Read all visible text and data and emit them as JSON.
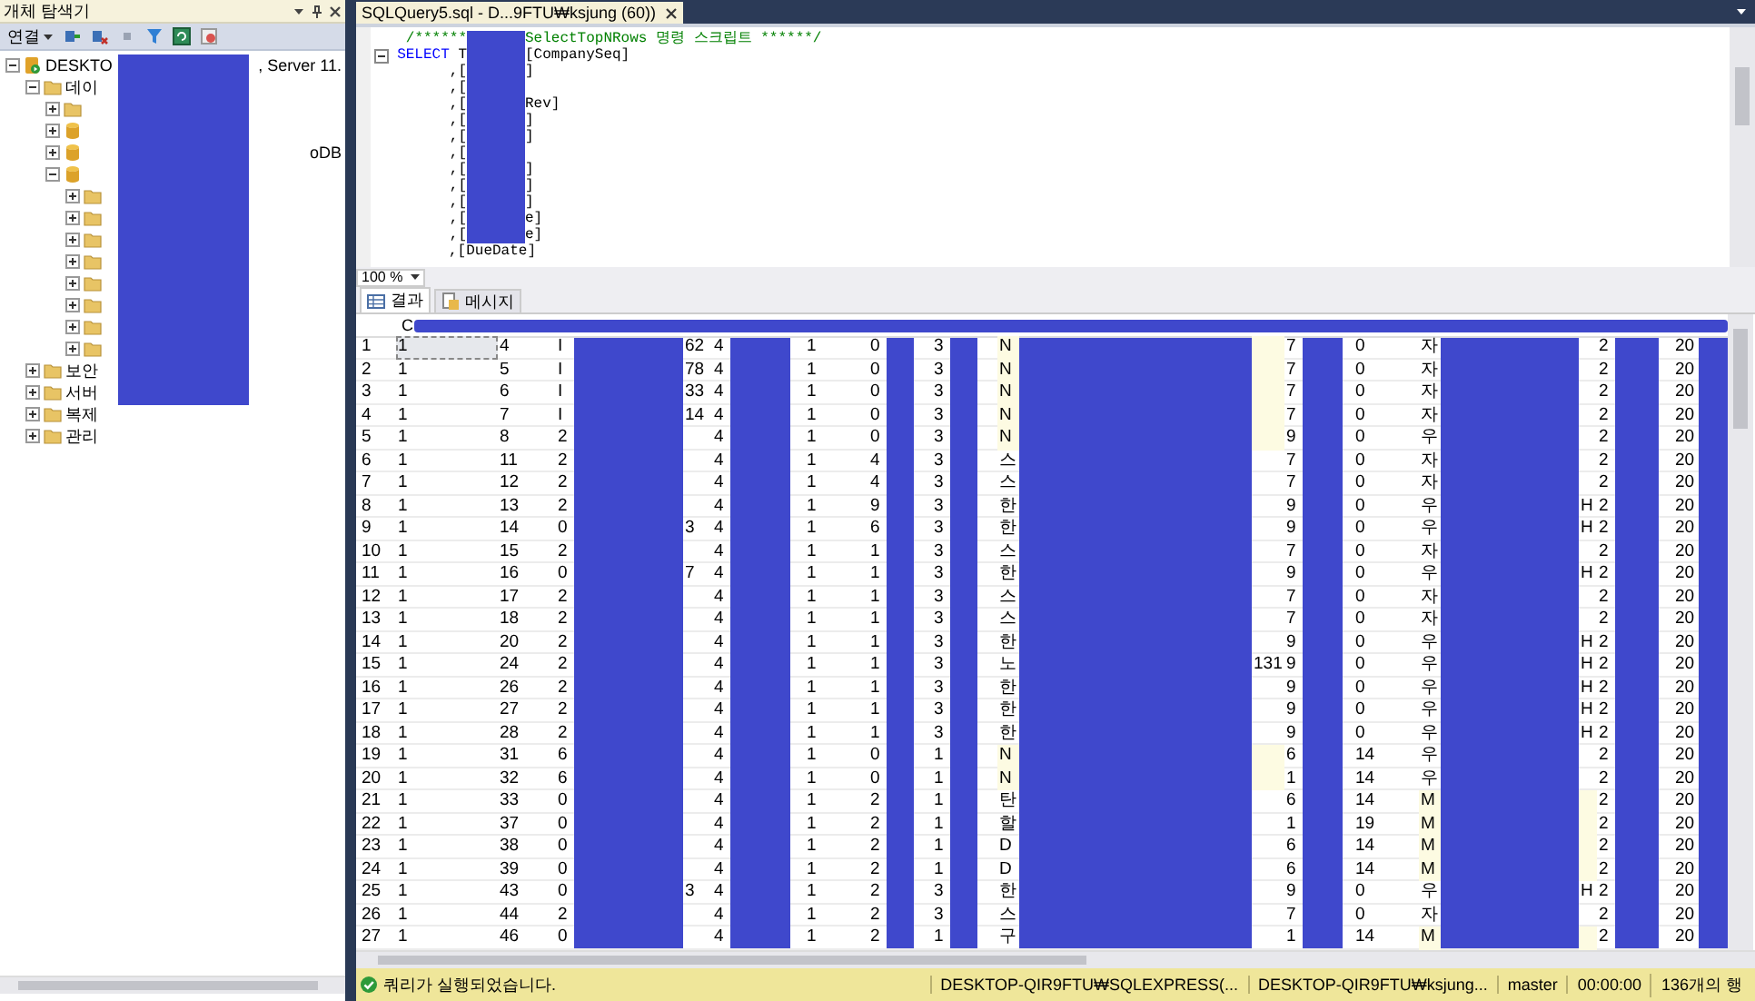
{
  "object_explorer": {
    "title": "개체 탐색기",
    "connect_label": "연결",
    "tree": [
      {
        "kind": "server",
        "label": "DESKTO",
        "tail": ", Server 11.",
        "expanded": true,
        "children": [
          {
            "kind": "folder",
            "label": "데이",
            "expanded": true,
            "children": [
              {
                "kind": "folder",
                "expanded": false
              },
              {
                "kind": "database",
                "expanded": false
              },
              {
                "kind": "database",
                "tail": "oDB",
                "expanded": false
              },
              {
                "kind": "database",
                "expanded": true,
                "children": [
                  {
                    "kind": "folder",
                    "expanded": false
                  },
                  {
                    "kind": "folder",
                    "expanded": false
                  },
                  {
                    "kind": "folder",
                    "expanded": false
                  },
                  {
                    "kind": "folder",
                    "expanded": false
                  },
                  {
                    "kind": "folder",
                    "expanded": false
                  },
                  {
                    "kind": "folder",
                    "expanded": false
                  },
                  {
                    "kind": "folder",
                    "expanded": false
                  },
                  {
                    "kind": "folder",
                    "expanded": false
                  }
                ]
              }
            ]
          },
          {
            "kind": "folder",
            "label": "보안",
            "expanded": false
          },
          {
            "kind": "folder",
            "label": "서버",
            "expanded": false
          },
          {
            "kind": "folder",
            "label": "복제",
            "expanded": false
          },
          {
            "kind": "folder",
            "label": "관리",
            "expanded": false
          }
        ]
      }
    ]
  },
  "editor": {
    "tab_title": "SQLQuery5.sql - D...9FTU₩ksjung (60))",
    "zoom": "100 %",
    "lines": [
      {
        "kind": "comment",
        "lead": "/******",
        "tail": "SelectTopNRows 명령 스크립트 ******/"
      },
      {
        "kind": "select",
        "keyword": "SELECT",
        "lead": "T",
        "tail": "[CompanySeq]"
      },
      {
        "kind": "column",
        "lead": ",[",
        "tail": "]"
      },
      {
        "kind": "column",
        "lead": ",["
      },
      {
        "kind": "column",
        "lead": ",[",
        "tail": "Rev]"
      },
      {
        "kind": "column",
        "lead": ",[",
        "tail": "]"
      },
      {
        "kind": "column",
        "lead": ",[",
        "tail": "]"
      },
      {
        "kind": "column",
        "lead": ",["
      },
      {
        "kind": "column",
        "lead": ",[",
        "tail": "]"
      },
      {
        "kind": "column",
        "lead": ",[",
        "tail": "]"
      },
      {
        "kind": "column",
        "lead": ",[",
        "tail": "]"
      },
      {
        "kind": "column",
        "lead": ",[",
        "tail": "e]"
      },
      {
        "kind": "column",
        "lead": ",[",
        "tail": "e]"
      },
      {
        "kind": "full",
        "lead": ",[DueDate]"
      }
    ]
  },
  "results": {
    "tabs": [
      {
        "label": "결과",
        "selected": true
      },
      {
        "label": "메시지",
        "selected": false
      }
    ],
    "header_fragment": "C",
    "rows": [
      {
        "n": "1",
        "selected": true,
        "column_9_shaded": true,
        "column_12_shaded": false,
        "cells": [
          "1",
          "4",
          "I",
          "62",
          "4",
          "1",
          "0",
          "3",
          "N",
          null,
          "7",
          "0",
          "자",
          null,
          "2",
          "20"
        ]
      },
      {
        "n": "2",
        "selected": false,
        "column_9_shaded": true,
        "column_12_shaded": false,
        "cells": [
          "1",
          "5",
          "I",
          "78",
          "4",
          "1",
          "0",
          "3",
          "N",
          null,
          "7",
          "0",
          "자",
          null,
          "2",
          "20"
        ]
      },
      {
        "n": "3",
        "selected": false,
        "column_9_shaded": true,
        "column_12_shaded": false,
        "cells": [
          "1",
          "6",
          "I",
          "33",
          "4",
          "1",
          "0",
          "3",
          "N",
          null,
          "7",
          "0",
          "자",
          null,
          "2",
          "20"
        ]
      },
      {
        "n": "4",
        "selected": false,
        "column_9_shaded": true,
        "column_12_shaded": false,
        "cells": [
          "1",
          "7",
          "I",
          "14",
          "4",
          "1",
          "0",
          "3",
          "N",
          null,
          "7",
          "0",
          "자",
          null,
          "2",
          "20"
        ]
      },
      {
        "n": "5",
        "selected": false,
        "column_9_shaded": true,
        "column_12_shaded": false,
        "cells": [
          "1",
          "8",
          "2",
          null,
          "4",
          "1",
          "0",
          "3",
          "N",
          null,
          "9",
          "0",
          "우",
          null,
          "2",
          "20"
        ]
      },
      {
        "n": "6",
        "selected": false,
        "column_9_shaded": false,
        "column_12_shaded": false,
        "cells": [
          "1",
          "11",
          "2",
          null,
          "4",
          "1",
          "4",
          "3",
          "스",
          null,
          "7",
          "0",
          "자",
          null,
          "2",
          "20"
        ]
      },
      {
        "n": "7",
        "selected": false,
        "column_9_shaded": false,
        "column_12_shaded": false,
        "cells": [
          "1",
          "12",
          "2",
          null,
          "4",
          "1",
          "4",
          "3",
          "스",
          null,
          "7",
          "0",
          "자",
          null,
          "2",
          "20"
        ]
      },
      {
        "n": "8",
        "selected": false,
        "column_9_shaded": false,
        "column_12_shaded": false,
        "cells": [
          "1",
          "13",
          "2",
          null,
          "4",
          "1",
          "9",
          "3",
          "한",
          null,
          "9",
          "0",
          "우",
          "H",
          "2",
          "20"
        ]
      },
      {
        "n": "9",
        "selected": false,
        "column_9_shaded": false,
        "column_12_shaded": false,
        "cells": [
          "1",
          "14",
          "0",
          "3",
          "4",
          "1",
          "6",
          "3",
          "한",
          null,
          "9",
          "0",
          "우",
          "H",
          "2",
          "20"
        ]
      },
      {
        "n": "10",
        "selected": false,
        "column_9_shaded": false,
        "column_12_shaded": false,
        "cells": [
          "1",
          "15",
          "2",
          null,
          "4",
          "1",
          "1",
          "3",
          "스",
          null,
          "7",
          "0",
          "자",
          null,
          "2",
          "20"
        ]
      },
      {
        "n": "11",
        "selected": false,
        "column_9_shaded": false,
        "column_12_shaded": false,
        "cells": [
          "1",
          "16",
          "0",
          "7",
          "4",
          "1",
          "1",
          "3",
          "한",
          null,
          "9",
          "0",
          "우",
          "H",
          "2",
          "20"
        ]
      },
      {
        "n": "12",
        "selected": false,
        "column_9_shaded": false,
        "column_12_shaded": false,
        "cells": [
          "1",
          "17",
          "2",
          null,
          "4",
          "1",
          "1",
          "3",
          "스",
          null,
          "7",
          "0",
          "자",
          null,
          "2",
          "20"
        ]
      },
      {
        "n": "13",
        "selected": false,
        "column_9_shaded": false,
        "column_12_shaded": false,
        "cells": [
          "1",
          "18",
          "2",
          null,
          "4",
          "1",
          "1",
          "3",
          "스",
          null,
          "7",
          "0",
          "자",
          null,
          "2",
          "20"
        ]
      },
      {
        "n": "14",
        "selected": false,
        "column_9_shaded": false,
        "column_12_shaded": false,
        "cells": [
          "1",
          "20",
          "2",
          null,
          "4",
          "1",
          "1",
          "3",
          "한",
          null,
          "9",
          "0",
          "우",
          "H",
          "2",
          "20"
        ]
      },
      {
        "n": "15",
        "selected": false,
        "column_9_shaded": false,
        "column_12_shaded": false,
        "cells": [
          "1",
          "24",
          "2",
          null,
          "4",
          "1",
          "1",
          "3",
          "노",
          "131",
          "9",
          "0",
          "우",
          "H",
          "2",
          "20"
        ]
      },
      {
        "n": "16",
        "selected": false,
        "column_9_shaded": false,
        "column_12_shaded": false,
        "cells": [
          "1",
          "26",
          "2",
          null,
          "4",
          "1",
          "1",
          "3",
          "한",
          null,
          "9",
          "0",
          "우",
          "H",
          "2",
          "20"
        ]
      },
      {
        "n": "17",
        "selected": false,
        "column_9_shaded": false,
        "column_12_shaded": false,
        "cells": [
          "1",
          "27",
          "2",
          null,
          "4",
          "1",
          "1",
          "3",
          "한",
          null,
          "9",
          "0",
          "우",
          "H",
          "2",
          "20"
        ]
      },
      {
        "n": "18",
        "selected": false,
        "column_9_shaded": false,
        "column_12_shaded": false,
        "cells": [
          "1",
          "28",
          "2",
          null,
          "4",
          "1",
          "1",
          "3",
          "한",
          null,
          "9",
          "0",
          "우",
          "H",
          "2",
          "20"
        ]
      },
      {
        "n": "19",
        "selected": false,
        "column_9_shaded": true,
        "column_12_shaded": false,
        "cells": [
          "1",
          "31",
          "6",
          null,
          "4",
          "1",
          "0",
          "1",
          "N",
          null,
          "6",
          "14",
          "우",
          null,
          "2",
          "20"
        ]
      },
      {
        "n": "20",
        "selected": false,
        "column_9_shaded": true,
        "column_12_shaded": false,
        "cells": [
          "1",
          "32",
          "6",
          null,
          "4",
          "1",
          "0",
          "1",
          "N",
          null,
          "1",
          "14",
          "우",
          null,
          "2",
          "20"
        ]
      },
      {
        "n": "21",
        "selected": false,
        "column_9_shaded": false,
        "column_12_shaded": true,
        "cells": [
          "1",
          "33",
          "0",
          null,
          "4",
          "1",
          "2",
          "1",
          "탄",
          null,
          "6",
          "14",
          "M",
          null,
          "2",
          "20"
        ]
      },
      {
        "n": "22",
        "selected": false,
        "column_9_shaded": false,
        "column_12_shaded": true,
        "cells": [
          "1",
          "37",
          "0",
          null,
          "4",
          "1",
          "2",
          "1",
          "할",
          null,
          "1",
          "19",
          "M",
          null,
          "2",
          "20"
        ]
      },
      {
        "n": "23",
        "selected": false,
        "column_9_shaded": false,
        "column_12_shaded": true,
        "cells": [
          "1",
          "38",
          "0",
          null,
          "4",
          "1",
          "2",
          "1",
          "D",
          null,
          "6",
          "14",
          "M",
          null,
          "2",
          "20"
        ]
      },
      {
        "n": "24",
        "selected": false,
        "column_9_shaded": false,
        "column_12_shaded": true,
        "cells": [
          "1",
          "39",
          "0",
          null,
          "4",
          "1",
          "2",
          "1",
          "D",
          null,
          "6",
          "14",
          "M",
          null,
          "2",
          "20"
        ]
      },
      {
        "n": "25",
        "selected": false,
        "column_9_shaded": false,
        "column_12_shaded": false,
        "cells": [
          "1",
          "43",
          "0",
          "3",
          "4",
          "1",
          "2",
          "3",
          "한",
          null,
          "9",
          "0",
          "우",
          "H",
          "2",
          "20"
        ]
      },
      {
        "n": "26",
        "selected": false,
        "column_9_shaded": false,
        "column_12_shaded": false,
        "cells": [
          "1",
          "44",
          "2",
          null,
          "4",
          "1",
          "2",
          "3",
          "스",
          null,
          "7",
          "0",
          "자",
          null,
          "2",
          "20"
        ]
      },
      {
        "n": "27",
        "selected": false,
        "column_9_shaded": false,
        "column_12_shaded": true,
        "cells": [
          "1",
          "46",
          "0",
          null,
          "4",
          "1",
          "2",
          "1",
          "구",
          null,
          "1",
          "14",
          "M",
          null,
          "2",
          "20"
        ]
      }
    ]
  },
  "status_bar": {
    "message": "쿼리가 실행되었습니다.",
    "server": "DESKTOP-QIR9FTU₩SQLEXPRESS(...",
    "user": "DESKTOP-QIR9FTU₩ksjung...",
    "database": "master",
    "elapsed": "00:00:00",
    "row_count": "136개의 행"
  }
}
